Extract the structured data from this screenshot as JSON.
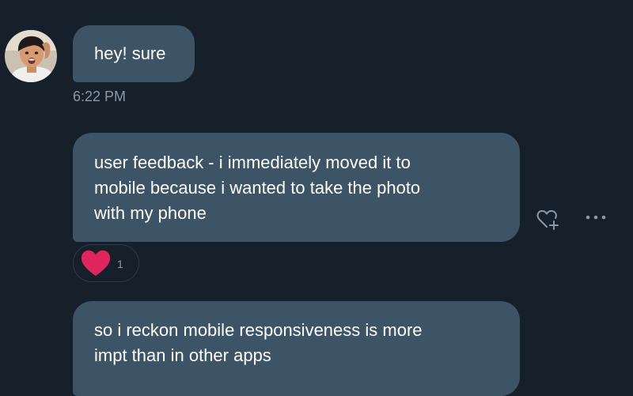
{
  "messages": [
    {
      "lines": [
        "hey! sure"
      ],
      "timestamp": "6:22 PM"
    },
    {
      "lines": [
        "user feedback - i immediately moved it to",
        "mobile because i wanted to take the photo",
        "with my phone"
      ],
      "reaction": {
        "icon": "heart-icon",
        "color": "#e0245e",
        "count": "1"
      }
    },
    {
      "lines": [
        "so i reckon mobile responsiveness is more",
        "impt than in other apps"
      ]
    }
  ],
  "actions": {
    "react_icon": "heart-plus-icon",
    "more_icon": "more-options-icon"
  },
  "colors": {
    "background": "#15202b",
    "bubble": "#3d5466",
    "text": "#ffffff",
    "muted": "#8b98a5",
    "heart": "#e0245e"
  }
}
